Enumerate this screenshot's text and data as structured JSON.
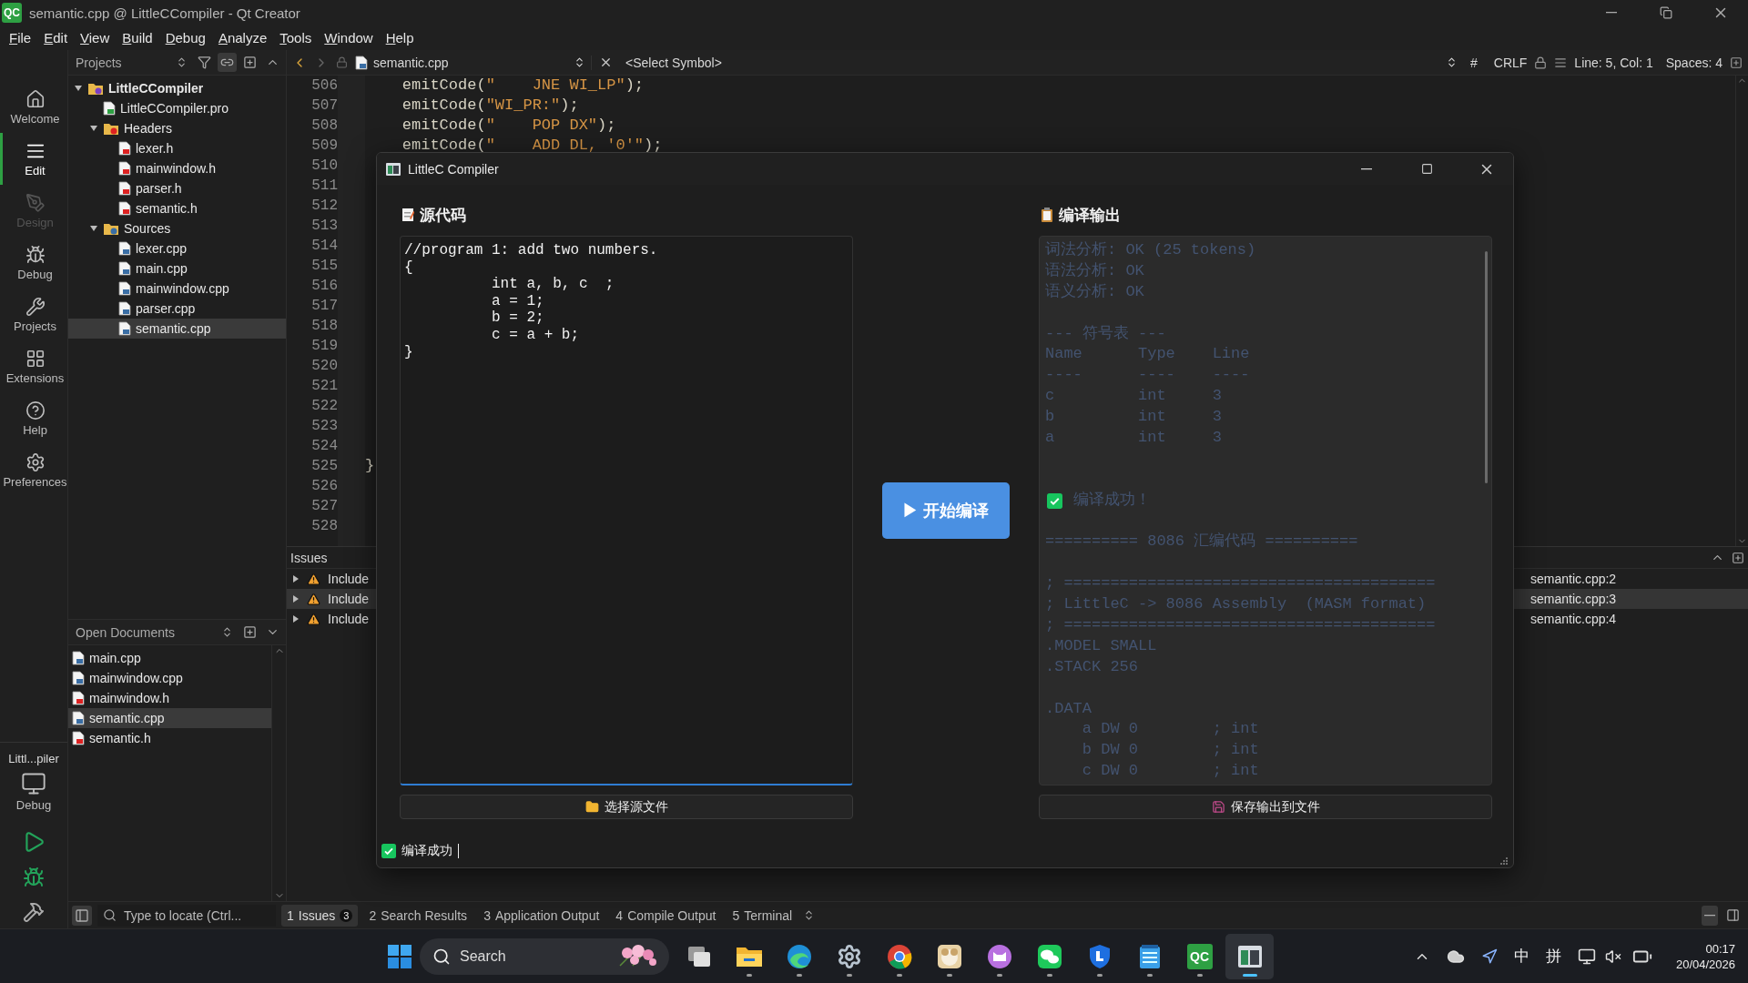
{
  "window": {
    "icon_text": "QC",
    "title": "semantic.cpp @ LittleCCompiler - Qt Creator"
  },
  "menu": [
    "File",
    "Edit",
    "View",
    "Build",
    "Debug",
    "Analyze",
    "Tools",
    "Window",
    "Help"
  ],
  "modes": [
    {
      "kind": "home",
      "label": "Welcome",
      "selected": false,
      "disabled": false
    },
    {
      "kind": "edit",
      "label": "Edit",
      "selected": true,
      "disabled": false
    },
    {
      "kind": "design",
      "label": "Design",
      "selected": false,
      "disabled": true
    },
    {
      "kind": "debug",
      "label": "Debug",
      "selected": false,
      "disabled": false
    },
    {
      "kind": "projects",
      "label": "Projects",
      "selected": false,
      "disabled": false
    },
    {
      "kind": "extensions",
      "label": "Extensions",
      "selected": false,
      "disabled": false
    },
    {
      "kind": "help",
      "label": "Help",
      "selected": false,
      "disabled": false
    },
    {
      "kind": "preferences",
      "label": "Preferences",
      "selected": false,
      "disabled": false
    }
  ],
  "run_target": {
    "project": "Littl...piler",
    "mode": "Debug"
  },
  "projects_pane": {
    "title": "Projects",
    "tree": [
      {
        "kind": "project",
        "label": "LittleCCompiler",
        "expanded": true,
        "selected": false,
        "children": [
          {
            "kind": "pro",
            "label": "LittleCCompiler.pro",
            "selected": false
          },
          {
            "kind": "headers",
            "label": "Headers",
            "expanded": true,
            "selected": false,
            "children": [
              {
                "kind": "header",
                "label": "lexer.h",
                "selected": false
              },
              {
                "kind": "header",
                "label": "mainwindow.h",
                "selected": false
              },
              {
                "kind": "header",
                "label": "parser.h",
                "selected": false
              },
              {
                "kind": "header",
                "label": "semantic.h",
                "selected": false
              }
            ]
          },
          {
            "kind": "sources",
            "label": "Sources",
            "expanded": true,
            "selected": false,
            "children": [
              {
                "kind": "source",
                "label": "lexer.cpp",
                "selected": false
              },
              {
                "kind": "source",
                "label": "main.cpp",
                "selected": false
              },
              {
                "kind": "source",
                "label": "mainwindow.cpp",
                "selected": false
              },
              {
                "kind": "source",
                "label": "parser.cpp",
                "selected": false
              },
              {
                "kind": "source",
                "label": "semantic.cpp",
                "selected": true
              }
            ]
          }
        ]
      }
    ]
  },
  "open_documents": {
    "title": "Open Documents",
    "items": [
      {
        "kind": "source",
        "label": "main.cpp",
        "selected": false
      },
      {
        "kind": "source",
        "label": "mainwindow.cpp",
        "selected": false
      },
      {
        "kind": "header",
        "label": "mainwindow.h",
        "selected": false
      },
      {
        "kind": "source",
        "label": "semantic.cpp",
        "selected": true
      },
      {
        "kind": "header",
        "label": "semantic.h",
        "selected": false
      }
    ]
  },
  "editor": {
    "file": "semantic.cpp",
    "symbol": "<Select Symbol>",
    "hash": "#",
    "line_ending": "CRLF",
    "position": "Line: 5, Col: 1",
    "indent": "Spaces: 4",
    "lines": [
      {
        "number": "506",
        "parts": [
          {
            "kind": "plain",
            "text": "    emitCode("
          },
          {
            "kind": "string",
            "text": "\"    JNE WI_LP\""
          },
          {
            "kind": "plain",
            "text": ");"
          }
        ]
      },
      {
        "number": "507",
        "parts": [
          {
            "kind": "plain",
            "text": "    emitCode("
          },
          {
            "kind": "string",
            "text": "\"WI_PR:\""
          },
          {
            "kind": "plain",
            "text": ");"
          }
        ]
      },
      {
        "number": "508",
        "parts": [
          {
            "kind": "plain",
            "text": "    emitCode("
          },
          {
            "kind": "string",
            "text": "\"    POP DX\""
          },
          {
            "kind": "plain",
            "text": ");"
          }
        ]
      },
      {
        "number": "509",
        "parts": [
          {
            "kind": "plain",
            "text": "    emitCode("
          },
          {
            "kind": "string",
            "text": "\"    ADD DL, '0'\""
          },
          {
            "kind": "plain",
            "text": ");"
          }
        ]
      },
      {
        "number": "510"
      },
      {
        "number": "511"
      },
      {
        "number": "512"
      },
      {
        "number": "513"
      },
      {
        "number": "514"
      },
      {
        "number": "515"
      },
      {
        "number": "516"
      },
      {
        "number": "517"
      },
      {
        "number": "518"
      },
      {
        "number": "519"
      },
      {
        "number": "520"
      },
      {
        "number": "521"
      },
      {
        "number": "522"
      },
      {
        "number": "523"
      },
      {
        "number": "524"
      },
      {
        "number": "525",
        "parts": [
          {
            "kind": "plain",
            "text": "}"
          }
        ]
      },
      {
        "number": "526"
      },
      {
        "number": "527"
      },
      {
        "number": "528"
      }
    ]
  },
  "issues": {
    "title": "Issues",
    "items": [
      {
        "text": "Include",
        "location": "semantic.cpp:2",
        "selected": false
      },
      {
        "text": "Include",
        "location": "semantic.cpp:3",
        "selected": true
      },
      {
        "text": "Include",
        "location": "semantic.cpp:4",
        "selected": false
      }
    ]
  },
  "dialog": {
    "title": "LittleC Compiler",
    "source": {
      "heading": "源代码",
      "lines": [
        "//program 1: add two numbers.",
        "{",
        "\tint a, b, c  ;",
        "\ta = 1;",
        "\tb = 2;",
        "\tc = a + b;",
        "}"
      ],
      "button": "选择源文件"
    },
    "compile_button": "▶ 开始编译",
    "output": {
      "heading": "编译输出",
      "button": "保存输出到文件",
      "lines": [
        {
          "kind": "text",
          "text": "词法分析: OK (25 tokens)"
        },
        {
          "kind": "text",
          "text": "语法分析: OK"
        },
        {
          "kind": "text",
          "text": "语义分析: OK"
        },
        {
          "kind": "gap"
        },
        {
          "kind": "text",
          "text": "--- 符号表 ---"
        },
        {
          "kind": "text",
          "text": "Name      Type    Line"
        },
        {
          "kind": "text",
          "text": "----      ----    ----"
        },
        {
          "kind": "text",
          "text": "c         int     3"
        },
        {
          "kind": "text",
          "text": "b         int     3"
        },
        {
          "kind": "text",
          "text": "a         int     3"
        },
        {
          "kind": "gap"
        },
        {
          "kind": "gap"
        },
        {
          "kind": "success",
          "text": "编译成功！"
        },
        {
          "kind": "gap"
        },
        {
          "kind": "text",
          "text": "========== 8086 汇编代码 =========="
        },
        {
          "kind": "gap"
        },
        {
          "kind": "text",
          "text": "; ========================================"
        },
        {
          "kind": "text",
          "text": "; LittleC -> 8086 Assembly  (MASM format)"
        },
        {
          "kind": "text",
          "text": "; ========================================"
        },
        {
          "kind": "text",
          "text": ".MODEL SMALL"
        },
        {
          "kind": "text",
          "text": ".STACK 256"
        },
        {
          "kind": "gap"
        },
        {
          "kind": "text",
          "text": ".DATA"
        },
        {
          "kind": "text",
          "text": "    a DW 0        ; int"
        },
        {
          "kind": "text",
          "text": "    b DW 0        ; int"
        },
        {
          "kind": "text",
          "text": "    c DW 0        ; int"
        }
      ]
    },
    "status": "编译成功"
  },
  "locator": {
    "placeholder": "Type to locate (Ctrl..."
  },
  "output_tabs": [
    {
      "number": "1",
      "label": "Issues",
      "count": "3",
      "selected": true
    },
    {
      "number": "2",
      "label": "Search Results",
      "selected": false
    },
    {
      "number": "3",
      "label": "Application Output",
      "selected": false
    },
    {
      "number": "4",
      "label": "Compile Output",
      "selected": false
    },
    {
      "number": "5",
      "label": "Terminal",
      "selected": false
    }
  ],
  "taskbar": {
    "search": "Search",
    "apps": [
      {
        "kind": "taskview",
        "running": false,
        "selected": false
      },
      {
        "kind": "folder",
        "running": true,
        "selected": false
      },
      {
        "kind": "swirl",
        "running": true,
        "selected": false
      },
      {
        "kind": "gear",
        "running": true,
        "selected": false
      },
      {
        "kind": "wheel",
        "running": true,
        "selected": false
      },
      {
        "kind": "sheep",
        "running": true,
        "selected": false
      },
      {
        "kind": "cat",
        "running": true,
        "selected": false
      },
      {
        "kind": "chat",
        "running": true,
        "selected": false
      },
      {
        "kind": "shield",
        "running": true,
        "selected": false
      },
      {
        "kind": "notepad",
        "running": true,
        "selected": false
      },
      {
        "kind": "logo",
        "label": "QC",
        "running": true,
        "selected": false
      },
      {
        "kind": "window",
        "running": true,
        "selected": true
      }
    ],
    "ime": [
      "中",
      "拼"
    ],
    "time": "00:17",
    "date": "20/04/2026"
  }
}
